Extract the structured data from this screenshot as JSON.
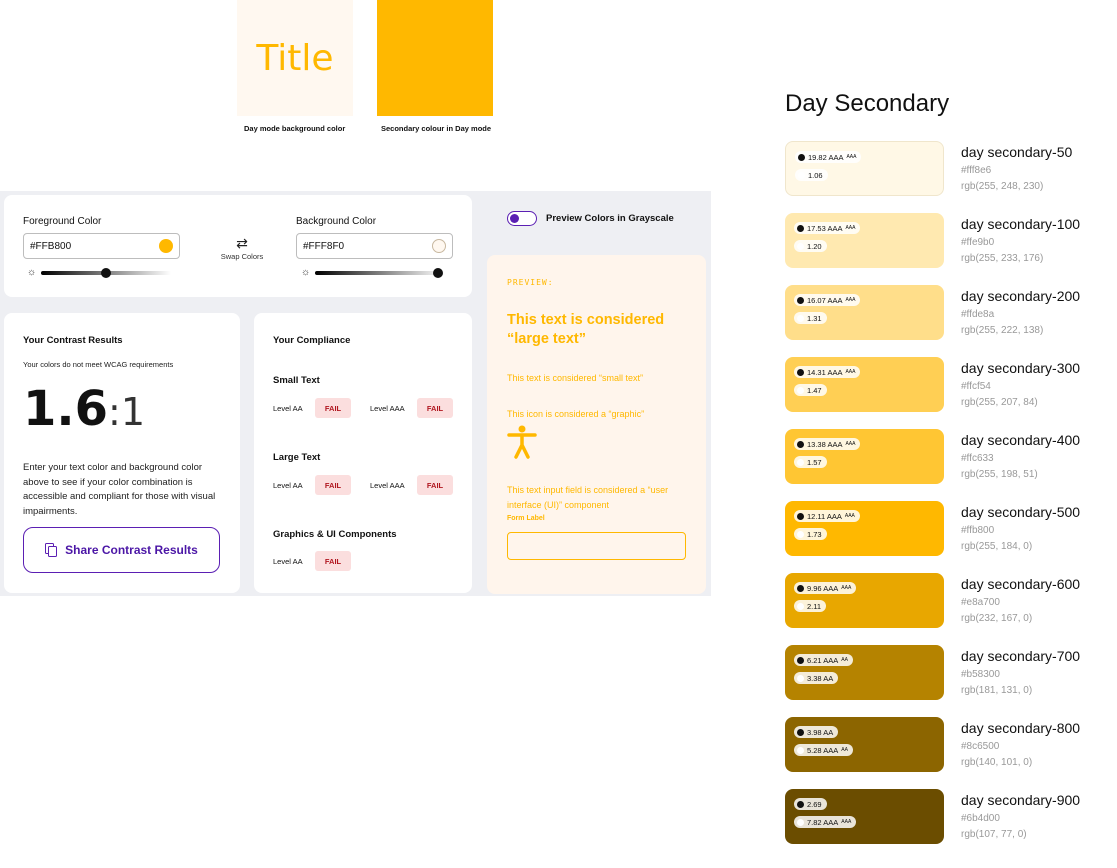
{
  "top_swatches": {
    "title_text": "Title",
    "caption_left": "Day mode background color",
    "caption_right": "Secondary colour in Day mode",
    "bg_color": "#FFF8F0",
    "secondary_color": "#FFB800"
  },
  "checker": {
    "foreground": {
      "label": "Foreground Color",
      "value": "#FFB800",
      "swatch": "#FFB800",
      "slider_level": 0.5
    },
    "background": {
      "label": "Background Color",
      "value": "#FFF8F0",
      "swatch": "#FFF8F0",
      "slider_level": 0.95
    },
    "swap_label": "Swap Colors",
    "toggle_label": "Preview Colors in Grayscale",
    "results": {
      "heading": "Your Contrast Results",
      "status": "Your colors do not meet WCAG requirements",
      "ratio": "1.6",
      "ratio_suffix": ":1",
      "description": "Enter your text color and background color above to see if your color combination is accessible and compliant for those with visual impairments.",
      "share_label": "Share Contrast Results"
    },
    "compliance": {
      "heading": "Your Compliance",
      "small_text": {
        "title": "Small Text",
        "aa_label": "Level AA",
        "aa_result": "FAIL",
        "aaa_label": "Level AAA",
        "aaa_result": "FAIL"
      },
      "large_text": {
        "title": "Large Text",
        "aa_label": "Level AA",
        "aa_result": "FAIL",
        "aaa_label": "Level AAA",
        "aaa_result": "FAIL"
      },
      "graphics": {
        "title": "Graphics & UI Components",
        "aa_label": "Level AA",
        "aa_result": "FAIL"
      }
    },
    "preview": {
      "label": "PREVIEW:",
      "large": "This text is considered “large text”",
      "small": "This text is considered “small text”",
      "icon": "This icon is considered a “graphic”",
      "input": "This text input field is considered a “user interface (UI)” component",
      "form_label": "Form Label"
    }
  },
  "palette": {
    "title": "Day Secondary",
    "swatches": [
      {
        "name": "day secondary-50",
        "hex": "#fff8e6",
        "rgb": "rgb(255, 248, 230)",
        "dark_ratio": "19.82 AAA",
        "dark_sup": "AAA",
        "light_ratio": "1.06",
        "light_sup": ""
      },
      {
        "name": "day secondary-100",
        "hex": "#ffe9b0",
        "rgb": "rgb(255, 233, 176)",
        "dark_ratio": "17.53 AAA",
        "dark_sup": "AAA",
        "light_ratio": "1.20",
        "light_sup": ""
      },
      {
        "name": "day secondary-200",
        "hex": "#ffde8a",
        "rgb": "rgb(255, 222, 138)",
        "dark_ratio": "16.07 AAA",
        "dark_sup": "AAA",
        "light_ratio": "1.31",
        "light_sup": ""
      },
      {
        "name": "day secondary-300",
        "hex": "#ffcf54",
        "rgb": "rgb(255, 207, 84)",
        "dark_ratio": "14.31 AAA",
        "dark_sup": "AAA",
        "light_ratio": "1.47",
        "light_sup": ""
      },
      {
        "name": "day secondary-400",
        "hex": "#ffc633",
        "rgb": "rgb(255, 198, 51)",
        "dark_ratio": "13.38 AAA",
        "dark_sup": "AAA",
        "light_ratio": "1.57",
        "light_sup": ""
      },
      {
        "name": "day secondary-500",
        "hex": "#ffb800",
        "rgb": "rgb(255, 184, 0)",
        "dark_ratio": "12.11 AAA",
        "dark_sup": "AAA",
        "light_ratio": "1.73",
        "light_sup": ""
      },
      {
        "name": "day secondary-600",
        "hex": "#e8a700",
        "rgb": "rgb(232, 167, 0)",
        "dark_ratio": "9.96 AAA",
        "dark_sup": "AAA",
        "light_ratio": "2.11",
        "light_sup": ""
      },
      {
        "name": "day secondary-700",
        "hex": "#b58300",
        "rgb": "rgb(181, 131, 0)",
        "dark_ratio": "6.21 AAA",
        "dark_sup": "AA",
        "light_ratio": "3.38 AA",
        "light_sup": ""
      },
      {
        "name": "day secondary-800",
        "hex": "#8c6500",
        "rgb": "rgb(140, 101, 0)",
        "dark_ratio": "3.98 AA",
        "dark_sup": "",
        "light_ratio": "5.28 AAA",
        "light_sup": "AA"
      },
      {
        "name": "day secondary-900",
        "hex": "#6b4d00",
        "rgb": "rgb(107, 77, 0)",
        "dark_ratio": "2.69",
        "dark_sup": "",
        "light_ratio": "7.82 AAA",
        "light_sup": "AAA"
      }
    ]
  }
}
